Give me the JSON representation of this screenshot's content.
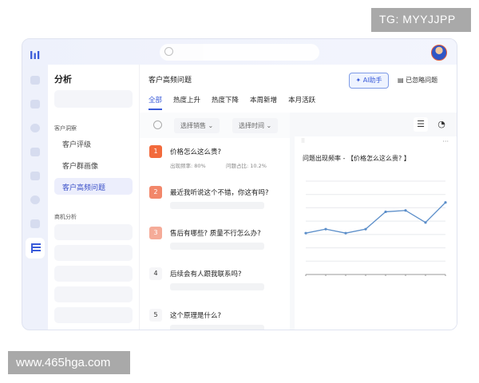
{
  "watermarks": {
    "top": "TG: MYYJJPP",
    "bottom": "www.465hga.com"
  },
  "sidebar": {
    "title": "分析",
    "section1": "客户洞察",
    "items": [
      "客户评级",
      "客户群画像",
      "客户高频问题"
    ],
    "section2": "商机分析",
    "active_index": 2
  },
  "header": {
    "title": "客户高频问题",
    "ai_button": "AI助手",
    "ignored_button": "已忽略问题"
  },
  "tabs": [
    "全部",
    "热度上升",
    "热度下降",
    "本周新增",
    "本月活跃"
  ],
  "filters": {
    "sales": "选择销售",
    "time": "选择时间"
  },
  "questions": [
    {
      "rank": "1",
      "text": "价格怎么这么贵?",
      "freq": "出现频率: 80%",
      "share": "问题占比: 10.2%",
      "color": "#f26a3c"
    },
    {
      "rank": "2",
      "text": "最近我听说这个不错，你这有吗?",
      "color": "#f2876a"
    },
    {
      "rank": "3",
      "text": "售后有哪些? 质量不行怎么办?",
      "color": "#f5ab98"
    },
    {
      "rank": "4",
      "text": "后续会有人跟我联系吗?"
    },
    {
      "rank": "5",
      "text": "这个原理是什么?"
    }
  ],
  "chart_data": {
    "type": "line",
    "title": "问题出现频率 - 【价格怎么这么贵? 】",
    "xlabel": "",
    "ylabel": "",
    "ylim": [
      0,
      7
    ],
    "grid": true,
    "color": "#5b8ec9",
    "x": [
      1,
      2,
      3,
      4,
      5,
      6,
      7,
      8
    ],
    "values": [
      3.1,
      3.4,
      3.1,
      3.4,
      4.7,
      4.8,
      3.9,
      5.4
    ]
  }
}
